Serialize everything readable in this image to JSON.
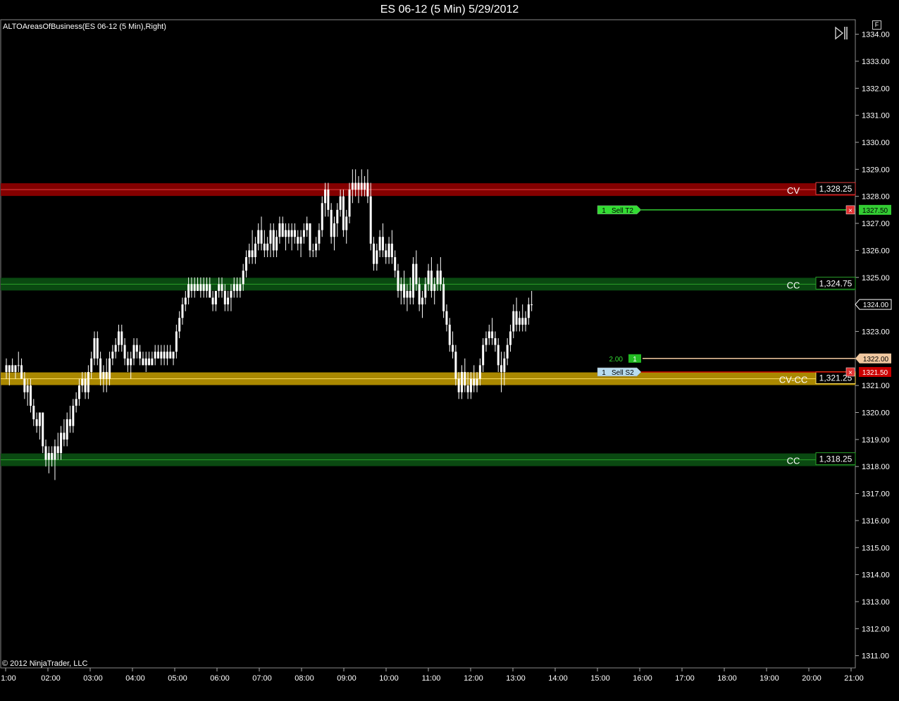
{
  "window": {
    "title": "ES 06-12 (5 Min)  5/29/2012",
    "indicator": "ALTOAreasOfBusiness(ES 06-12 (5 Min),Right)",
    "copyright": "© 2012 NinjaTrader, LLC",
    "f_label": "F"
  },
  "colors": {
    "background": "#000000",
    "candle": "#ffffff",
    "zone_red": "#8b0000",
    "zone_green": "#0b4d12",
    "zone_gold": "#b38f00",
    "order_green": "#33cc33",
    "order_red": "#cc0000",
    "last_price": "#f0c8a0"
  },
  "chart_data": {
    "type": "candlestick",
    "ylim": [
      1310.5,
      1334.4
    ],
    "y_ticks": [
      "1311.00",
      "1312.00",
      "1313.00",
      "1314.00",
      "1315.00",
      "1316.00",
      "1317.00",
      "1318.00",
      "1319.00",
      "1320.00",
      "1321.00",
      "1322.00",
      "1323.00",
      "1324.00",
      "1325.00",
      "1326.00",
      "1327.00",
      "1328.00",
      "1329.00",
      "1330.00",
      "1331.00",
      "1332.00",
      "1333.00",
      "1334.00"
    ],
    "x_ticks": [
      "1:00",
      "02:00",
      "03:00",
      "04:00",
      "05:00",
      "06:00",
      "07:00",
      "08:00",
      "09:00",
      "10:00",
      "11:00",
      "12:00",
      "13:00",
      "14:00",
      "15:00",
      "16:00",
      "17:00",
      "18:00",
      "19:00",
      "20:00",
      "21:00"
    ],
    "zones": [
      {
        "name": "CV",
        "price": 1328.25,
        "label": "1,328.25",
        "color": "red"
      },
      {
        "name": "CC",
        "price": 1324.75,
        "label": "1,324.75",
        "color": "green"
      },
      {
        "name": "CV-CC",
        "price": 1321.25,
        "label": "1,321.25",
        "color": "gold"
      },
      {
        "name": "CC",
        "price": 1318.25,
        "label": "1,318.25",
        "color": "green"
      }
    ],
    "orders": [
      {
        "qty": "1",
        "label": "Sell T2",
        "price": 1327.5,
        "price_label": "1327.50",
        "color": "green"
      },
      {
        "qty": "1",
        "label": "Sell S2",
        "price": 1321.5,
        "price_label": "1321.50",
        "color": "red"
      }
    ],
    "position": {
      "qty_label": "2.00",
      "qty": "1",
      "price": 1322.0,
      "price_label": "1322.00"
    },
    "last_price": {
      "price": 1324.0,
      "label": "1324.00"
    },
    "candles": [
      [
        1321.75,
        1322.0,
        1321.25,
        1321.5
      ],
      [
        1321.5,
        1321.75,
        1321.0,
        1321.75
      ],
      [
        1321.75,
        1322.0,
        1321.5,
        1321.5
      ],
      [
        1321.5,
        1321.75,
        1321.25,
        1321.75
      ],
      [
        1321.75,
        1322.25,
        1321.5,
        1321.75
      ],
      [
        1321.75,
        1322.0,
        1321.25,
        1321.25
      ],
      [
        1321.25,
        1321.5,
        1320.5,
        1320.75
      ],
      [
        1320.75,
        1321.25,
        1320.25,
        1321.0
      ],
      [
        1321.0,
        1321.25,
        1320.0,
        1320.25
      ],
      [
        1320.25,
        1320.5,
        1319.5,
        1319.75
      ],
      [
        1319.75,
        1320.0,
        1319.25,
        1319.5
      ],
      [
        1319.5,
        1320.0,
        1319.0,
        1320.0
      ],
      [
        1320.0,
        1320.0,
        1318.5,
        1318.75
      ],
      [
        1318.75,
        1319.0,
        1318.0,
        1318.25
      ],
      [
        1318.25,
        1318.75,
        1317.75,
        1318.5
      ],
      [
        1318.5,
        1318.75,
        1318.0,
        1318.25
      ],
      [
        1318.25,
        1319.0,
        1317.5,
        1318.75
      ],
      [
        1318.75,
        1319.25,
        1318.25,
        1318.5
      ],
      [
        1318.5,
        1319.5,
        1318.25,
        1319.25
      ],
      [
        1319.25,
        1319.75,
        1318.75,
        1319.0
      ],
      [
        1319.0,
        1320.0,
        1318.75,
        1319.75
      ],
      [
        1319.75,
        1320.25,
        1319.25,
        1319.5
      ],
      [
        1319.5,
        1320.5,
        1319.25,
        1320.25
      ],
      [
        1320.25,
        1320.75,
        1320.0,
        1320.5
      ],
      [
        1320.5,
        1321.25,
        1320.25,
        1321.0
      ],
      [
        1321.0,
        1321.5,
        1320.75,
        1321.25
      ],
      [
        1321.25,
        1321.5,
        1320.5,
        1320.75
      ],
      [
        1320.75,
        1321.75,
        1320.5,
        1321.5
      ],
      [
        1321.5,
        1322.25,
        1321.25,
        1322.0
      ],
      [
        1322.0,
        1323.0,
        1321.75,
        1322.75
      ],
      [
        1322.75,
        1323.0,
        1321.75,
        1322.0
      ],
      [
        1322.0,
        1322.25,
        1321.0,
        1321.25
      ],
      [
        1321.25,
        1321.75,
        1320.75,
        1321.5
      ],
      [
        1321.5,
        1322.0,
        1320.75,
        1321.25
      ],
      [
        1321.25,
        1322.25,
        1321.0,
        1322.0
      ],
      [
        1322.0,
        1322.5,
        1321.75,
        1322.25
      ],
      [
        1322.25,
        1322.75,
        1322.0,
        1322.5
      ],
      [
        1322.5,
        1323.25,
        1322.25,
        1323.0
      ],
      [
        1323.0,
        1323.25,
        1322.25,
        1322.5
      ],
      [
        1322.5,
        1322.75,
        1321.75,
        1322.0
      ],
      [
        1322.0,
        1322.25,
        1321.5,
        1321.75
      ],
      [
        1321.75,
        1322.25,
        1321.25,
        1322.0
      ],
      [
        1322.0,
        1322.75,
        1321.75,
        1322.5
      ],
      [
        1322.5,
        1322.75,
        1322.0,
        1322.25
      ],
      [
        1322.25,
        1322.5,
        1321.75,
        1322.0
      ],
      [
        1322.0,
        1322.25,
        1321.75,
        1321.75
      ],
      [
        1321.75,
        1322.25,
        1321.5,
        1322.0
      ],
      [
        1322.0,
        1322.25,
        1321.75,
        1321.75
      ],
      [
        1321.75,
        1322.25,
        1321.75,
        1322.0
      ],
      [
        1322.0,
        1322.5,
        1321.75,
        1322.25
      ],
      [
        1322.25,
        1322.5,
        1322.0,
        1322.0
      ],
      [
        1322.0,
        1322.5,
        1321.75,
        1322.25
      ],
      [
        1322.25,
        1322.5,
        1321.75,
        1322.0
      ],
      [
        1322.0,
        1322.5,
        1321.75,
        1322.25
      ],
      [
        1322.25,
        1322.5,
        1322.0,
        1322.0
      ],
      [
        1322.0,
        1322.25,
        1321.75,
        1322.25
      ],
      [
        1322.25,
        1323.25,
        1322.0,
        1323.0
      ],
      [
        1323.0,
        1323.75,
        1322.75,
        1323.5
      ],
      [
        1323.5,
        1324.25,
        1323.25,
        1324.0
      ],
      [
        1324.0,
        1324.5,
        1323.75,
        1324.25
      ],
      [
        1324.25,
        1325.0,
        1324.0,
        1324.75
      ],
      [
        1324.75,
        1325.0,
        1324.25,
        1324.5
      ],
      [
        1324.5,
        1325.0,
        1324.25,
        1324.75
      ],
      [
        1324.75,
        1325.0,
        1324.5,
        1324.5
      ],
      [
        1324.5,
        1325.0,
        1324.25,
        1324.75
      ],
      [
        1324.75,
        1325.0,
        1324.25,
        1324.5
      ],
      [
        1324.5,
        1325.0,
        1324.25,
        1324.75
      ],
      [
        1324.75,
        1325.0,
        1324.25,
        1324.25
      ],
      [
        1324.25,
        1324.5,
        1323.75,
        1324.0
      ],
      [
        1324.0,
        1324.5,
        1323.75,
        1324.5
      ],
      [
        1324.5,
        1325.0,
        1324.25,
        1324.75
      ],
      [
        1324.75,
        1325.0,
        1324.25,
        1324.5
      ],
      [
        1324.5,
        1324.75,
        1323.75,
        1324.0
      ],
      [
        1324.0,
        1324.5,
        1323.75,
        1324.25
      ],
      [
        1324.25,
        1324.75,
        1323.75,
        1324.5
      ],
      [
        1324.5,
        1325.0,
        1324.25,
        1324.75
      ],
      [
        1324.75,
        1325.0,
        1324.25,
        1324.5
      ],
      [
        1324.5,
        1325.0,
        1324.25,
        1324.75
      ],
      [
        1324.75,
        1325.5,
        1324.5,
        1325.25
      ],
      [
        1325.25,
        1326.0,
        1325.0,
        1325.75
      ],
      [
        1325.75,
        1326.25,
        1325.5,
        1326.0
      ],
      [
        1326.0,
        1326.75,
        1325.5,
        1325.75
      ],
      [
        1325.75,
        1326.5,
        1325.5,
        1326.25
      ],
      [
        1326.25,
        1327.0,
        1326.0,
        1326.75
      ],
      [
        1326.75,
        1327.25,
        1326.0,
        1326.25
      ],
      [
        1326.25,
        1326.75,
        1325.75,
        1326.0
      ],
      [
        1326.0,
        1326.5,
        1325.75,
        1326.25
      ],
      [
        1326.25,
        1327.0,
        1325.75,
        1326.75
      ],
      [
        1326.75,
        1327.0,
        1325.75,
        1326.0
      ],
      [
        1326.0,
        1326.75,
        1325.75,
        1326.5
      ],
      [
        1326.5,
        1327.25,
        1326.25,
        1327.0
      ],
      [
        1327.0,
        1327.25,
        1326.5,
        1326.5
      ],
      [
        1326.5,
        1327.0,
        1326.0,
        1326.75
      ],
      [
        1326.75,
        1327.0,
        1326.25,
        1326.5
      ],
      [
        1326.5,
        1327.0,
        1326.0,
        1326.75
      ],
      [
        1326.75,
        1327.0,
        1326.25,
        1326.5
      ],
      [
        1326.5,
        1326.75,
        1326.0,
        1326.25
      ],
      [
        1326.25,
        1326.75,
        1325.75,
        1326.5
      ],
      [
        1326.5,
        1327.0,
        1326.25,
        1326.75
      ],
      [
        1326.75,
        1327.25,
        1326.5,
        1327.0
      ],
      [
        1327.0,
        1327.0,
        1325.75,
        1326.0
      ],
      [
        1326.0,
        1326.25,
        1325.75,
        1326.0
      ],
      [
        1326.0,
        1326.5,
        1325.75,
        1326.25
      ],
      [
        1326.25,
        1327.0,
        1326.0,
        1326.75
      ],
      [
        1326.75,
        1328.0,
        1326.5,
        1327.75
      ],
      [
        1327.75,
        1328.5,
        1327.25,
        1328.25
      ],
      [
        1328.25,
        1328.5,
        1327.25,
        1327.5
      ],
      [
        1327.5,
        1327.75,
        1326.25,
        1326.5
      ],
      [
        1326.5,
        1327.25,
        1326.0,
        1327.0
      ],
      [
        1327.0,
        1327.75,
        1326.5,
        1327.5
      ],
      [
        1327.5,
        1328.25,
        1327.25,
        1328.0
      ],
      [
        1328.0,
        1328.25,
        1326.5,
        1326.75
      ],
      [
        1326.75,
        1327.5,
        1326.25,
        1327.25
      ],
      [
        1327.25,
        1328.5,
        1327.0,
        1328.25
      ],
      [
        1328.25,
        1329.0,
        1327.75,
        1328.5
      ],
      [
        1328.5,
        1329.0,
        1328.0,
        1328.25
      ],
      [
        1328.25,
        1328.75,
        1327.75,
        1328.5
      ],
      [
        1328.5,
        1329.0,
        1328.0,
        1328.25
      ],
      [
        1328.25,
        1328.75,
        1328.0,
        1328.5
      ],
      [
        1328.5,
        1329.0,
        1327.75,
        1328.0
      ],
      [
        1328.0,
        1328.5,
        1326.0,
        1326.25
      ],
      [
        1326.25,
        1326.5,
        1325.25,
        1325.5
      ],
      [
        1325.5,
        1326.25,
        1325.25,
        1326.0
      ],
      [
        1326.0,
        1326.75,
        1325.75,
        1326.5
      ],
      [
        1326.5,
        1327.0,
        1325.75,
        1326.0
      ],
      [
        1326.0,
        1326.25,
        1325.5,
        1325.75
      ],
      [
        1325.75,
        1326.5,
        1325.5,
        1326.25
      ],
      [
        1326.25,
        1326.75,
        1325.5,
        1325.75
      ],
      [
        1325.75,
        1326.0,
        1325.0,
        1325.25
      ],
      [
        1325.25,
        1325.5,
        1324.25,
        1324.5
      ],
      [
        1324.5,
        1325.0,
        1324.0,
        1324.75
      ],
      [
        1324.75,
        1325.25,
        1324.0,
        1324.25
      ],
      [
        1324.25,
        1324.75,
        1323.75,
        1324.5
      ],
      [
        1324.5,
        1325.0,
        1324.0,
        1324.25
      ],
      [
        1324.25,
        1325.75,
        1324.0,
        1325.5
      ],
      [
        1325.5,
        1326.0,
        1324.5,
        1324.75
      ],
      [
        1324.75,
        1325.0,
        1323.75,
        1324.0
      ],
      [
        1324.0,
        1324.5,
        1323.5,
        1324.25
      ],
      [
        1324.25,
        1325.0,
        1324.0,
        1324.75
      ],
      [
        1324.75,
        1325.5,
        1324.5,
        1325.25
      ],
      [
        1325.25,
        1325.75,
        1324.25,
        1324.5
      ],
      [
        1324.5,
        1325.0,
        1324.0,
        1324.75
      ],
      [
        1324.75,
        1325.5,
        1324.5,
        1325.25
      ],
      [
        1325.25,
        1325.75,
        1324.5,
        1324.75
      ],
      [
        1324.75,
        1325.0,
        1323.5,
        1323.75
      ],
      [
        1323.75,
        1324.0,
        1323.0,
        1323.25
      ],
      [
        1323.25,
        1323.5,
        1322.25,
        1322.5
      ],
      [
        1322.5,
        1323.0,
        1322.0,
        1322.25
      ],
      [
        1322.25,
        1322.5,
        1321.0,
        1321.25
      ],
      [
        1321.25,
        1321.5,
        1320.5,
        1320.75
      ],
      [
        1320.75,
        1321.75,
        1320.5,
        1321.5
      ],
      [
        1321.5,
        1322.0,
        1320.75,
        1321.0
      ],
      [
        1321.0,
        1321.5,
        1320.5,
        1320.75
      ],
      [
        1320.75,
        1321.5,
        1320.5,
        1321.25
      ],
      [
        1321.25,
        1321.75,
        1320.75,
        1321.0
      ],
      [
        1321.0,
        1321.5,
        1320.75,
        1321.25
      ],
      [
        1321.25,
        1322.0,
        1321.0,
        1321.75
      ],
      [
        1321.75,
        1322.75,
        1321.5,
        1322.5
      ],
      [
        1322.5,
        1323.0,
        1322.25,
        1322.75
      ],
      [
        1322.75,
        1323.25,
        1322.5,
        1323.0
      ],
      [
        1323.0,
        1323.5,
        1322.5,
        1322.75
      ],
      [
        1322.75,
        1323.0,
        1322.25,
        1322.5
      ],
      [
        1322.5,
        1322.75,
        1321.5,
        1321.75
      ],
      [
        1321.75,
        1322.25,
        1320.75,
        1321.5
      ],
      [
        1321.5,
        1322.25,
        1321.0,
        1322.0
      ],
      [
        1322.0,
        1322.75,
        1321.75,
        1322.5
      ],
      [
        1322.5,
        1323.25,
        1322.25,
        1323.0
      ],
      [
        1323.0,
        1324.0,
        1322.75,
        1323.75
      ],
      [
        1323.75,
        1324.25,
        1323.0,
        1323.25
      ],
      [
        1323.25,
        1323.75,
        1323.0,
        1323.5
      ],
      [
        1323.5,
        1324.0,
        1323.0,
        1323.25
      ],
      [
        1323.25,
        1323.75,
        1323.0,
        1323.5
      ],
      [
        1323.5,
        1324.25,
        1323.25,
        1324.0
      ],
      [
        1324.0,
        1324.5,
        1323.75,
        1324.0
      ]
    ]
  }
}
